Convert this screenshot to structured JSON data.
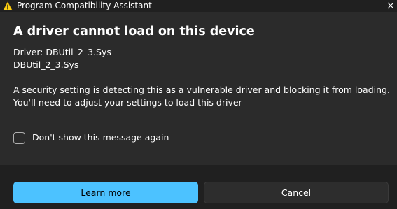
{
  "window": {
    "title": "Program Compatibility Assistant",
    "title_icon": "warning-icon",
    "close_icon": "close-icon"
  },
  "dialog": {
    "heading": "A driver cannot load on this device",
    "driver_label_line": "Driver: DBUtil_2_3.Sys",
    "driver_file_line": "DBUtil_2_3.Sys",
    "message_line_1": "A security setting is detecting this as a vulnerable driver and blocking it from loading.",
    "message_line_2": "You'll need to adjust your settings to load this driver",
    "checkbox_label": "Don't show this message again",
    "checkbox_checked": false
  },
  "buttons": {
    "primary_label": "Learn more",
    "secondary_label": "Cancel"
  },
  "colors": {
    "accent": "#4cc2ff",
    "background": "#2b2b2b",
    "footer": "#202020",
    "warning": "#fcd116"
  }
}
